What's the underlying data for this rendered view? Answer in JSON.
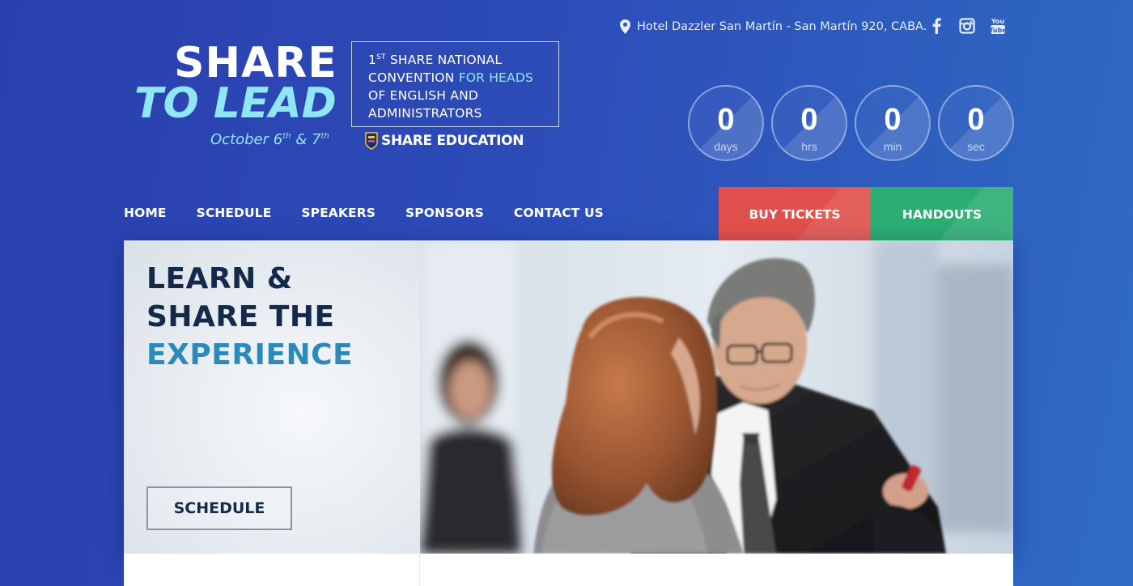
{
  "logo": {
    "share": "SHARE",
    "to_lead": "TO LEAD",
    "date_prefix": "October 6",
    "date_sup1": "th",
    "date_mid": " & 7",
    "date_sup2": "th"
  },
  "convention": {
    "line1_sup": "1ST",
    "line1_num": "1",
    "line1_suffix": "ST",
    "line1_text": " SHARE NATIONAL",
    "line2a": "CONVENTION ",
    "line2b": "FOR HEADS",
    "line3": "OF ENGLISH AND",
    "line4": "ADMINISTRATORS"
  },
  "brand": {
    "share_education": "SHARE EDUCATION"
  },
  "address": {
    "text": "Hotel Dazzler San Martín - San Martín 920, CABA.",
    "icon": "map-pin-icon"
  },
  "social": [
    {
      "name": "facebook-icon"
    },
    {
      "name": "instagram-icon"
    },
    {
      "name": "youtube-icon"
    }
  ],
  "countdown": [
    {
      "value": "0",
      "unit": "days"
    },
    {
      "value": "0",
      "unit": "hrs"
    },
    {
      "value": "0",
      "unit": "min"
    },
    {
      "value": "0",
      "unit": "sec"
    }
  ],
  "nav": [
    {
      "label": "HOME"
    },
    {
      "label": "SCHEDULE"
    },
    {
      "label": "SPEAKERS"
    },
    {
      "label": "SPONSORS"
    },
    {
      "label": "CONTACT US"
    }
  ],
  "cta": {
    "buy": "BUY TICKETS",
    "handouts": "HANDOUTS"
  },
  "hero": {
    "line1": "LEARN &",
    "line2": "SHARE THE",
    "line3": "EXPERIENCE",
    "button": "SCHEDULE"
  },
  "colors": {
    "accent_cyan": "#8fe6f7",
    "buy": "#e0504c",
    "handouts": "#2cad73",
    "headline": "#152a4a",
    "headline_accent": "#2d8ab8"
  }
}
